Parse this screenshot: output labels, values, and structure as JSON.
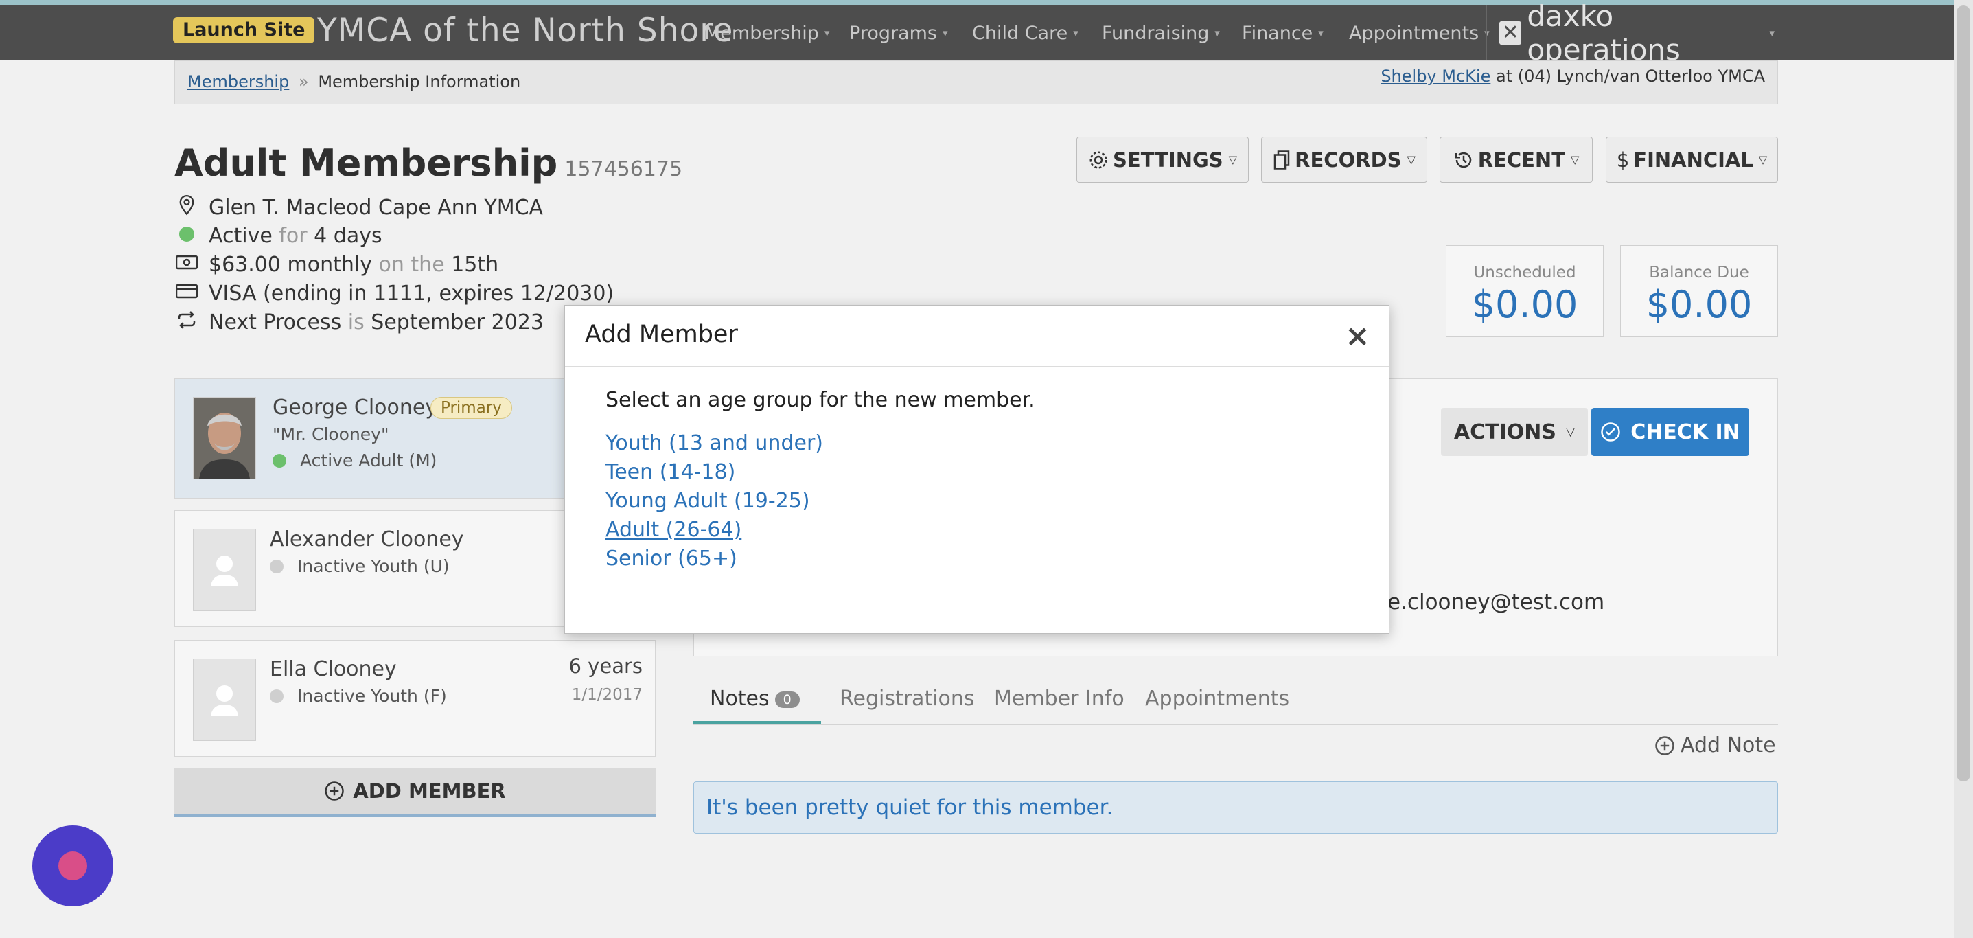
{
  "topbar": {
    "launch_label": "Launch Site",
    "brand": "YMCA of the North Shore",
    "nav": [
      "Membership",
      "Programs",
      "Child Care",
      "Fundraising",
      "Finance",
      "Appointments"
    ],
    "caret": "▾",
    "product": "daxko operations"
  },
  "breadcrumb": {
    "parent": "Membership",
    "sep": "»",
    "current": "Membership Information"
  },
  "user": {
    "name": "Shelby McKie",
    "at": "at (04) Lynch/van Otterloo YMCA"
  },
  "membership": {
    "title": "Adult Membership",
    "number": "157456175",
    "location": "Glen T. Macleod Cape Ann YMCA",
    "status": "Active",
    "status_for": "for",
    "status_duration": "4 days",
    "price": "$63.00 monthly",
    "price_on": "on the",
    "price_day": "15th",
    "card": "VISA (ending in 1111, expires 12/2030)",
    "next_label": "Next Process",
    "next_is": "is",
    "next_date": "September 2023"
  },
  "header_buttons": {
    "settings": "SETTINGS",
    "records": "RECORDS",
    "recent": "RECENT",
    "financial": "FINANCIAL"
  },
  "summary": {
    "unscheduled_label": "Unscheduled",
    "unscheduled_value": "$0.00",
    "balance_label": "Balance Due",
    "balance_value": "$0.00"
  },
  "members": [
    {
      "name": "George Clooney",
      "badge": "Primary",
      "nickname": "\"Mr. Clooney\"",
      "status": "Active Adult (M)",
      "status_color": "#6cc06c"
    },
    {
      "name": "Alexander Clooney",
      "status": "Inactive Youth (U)",
      "status_color": "#cfcfcf"
    },
    {
      "name": "Ella Clooney",
      "status": "Inactive Youth (F)",
      "age": "6 years",
      "dob": "1/1/2017",
      "status_color": "#cfcfcf"
    }
  ],
  "add_member_label": "ADD MEMBER",
  "detail": {
    "actions_label": "ACTIONS",
    "checkin_label": "CHECK IN",
    "email_fragment": "e.clooney@test.com"
  },
  "tabs": {
    "notes": "Notes",
    "notes_count": "0",
    "registrations": "Registrations",
    "member_info": "Member Info",
    "appointments": "Appointments"
  },
  "add_note_label": "Add Note",
  "empty_message": "It's been pretty quiet for this member.",
  "modal": {
    "title": "Add Member",
    "close": "×",
    "prompt": "Select an age group for the new member.",
    "options": [
      "Youth (13 and under)",
      "Teen (14-18)",
      "Young Adult (19-25)",
      "Adult (26-64)",
      "Senior (65+)"
    ]
  },
  "colors": {
    "accent": "#2b72b8",
    "active_green": "#6cc06c",
    "launch_yellow": "#e4c65a",
    "checkin_blue": "#2f7fc7"
  }
}
